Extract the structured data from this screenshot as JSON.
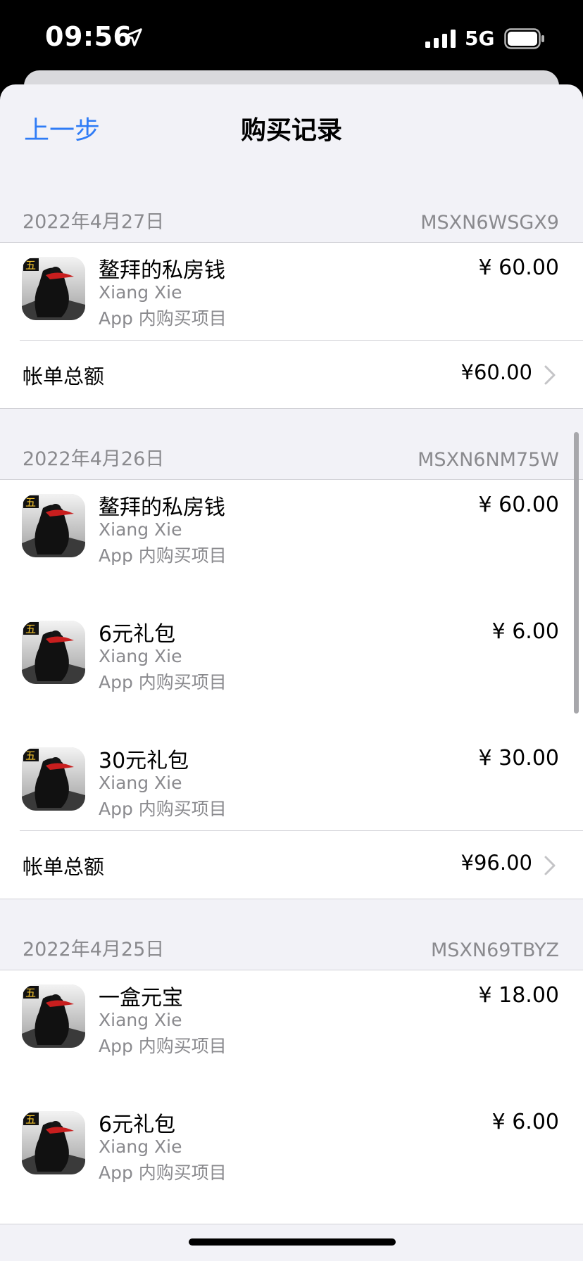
{
  "status": {
    "time": "09:56",
    "network": "5G"
  },
  "nav": {
    "back": "上一步",
    "title": "购买记录"
  },
  "sections": [
    {
      "date": "2022年4月27日",
      "order_id": "MSXN6WSGX9",
      "items": [
        {
          "name": "鳌拜的私房钱",
          "developer": "Xiang Xie",
          "type": "App 内购买项目",
          "price": "¥ 60.00"
        }
      ],
      "total_label": "帐单总额",
      "total": "¥60.00"
    },
    {
      "date": "2022年4月26日",
      "order_id": "MSXN6NM75W",
      "items": [
        {
          "name": "鳌拜的私房钱",
          "developer": "Xiang Xie",
          "type": "App 内购买项目",
          "price": "¥ 60.00"
        },
        {
          "name": "6元礼包",
          "developer": "Xiang Xie",
          "type": "App 内购买项目",
          "price": "¥ 6.00"
        },
        {
          "name": "30元礼包",
          "developer": "Xiang Xie",
          "type": "App 内购买项目",
          "price": "¥ 30.00"
        }
      ],
      "total_label": "帐单总额",
      "total": "¥96.00"
    },
    {
      "date": "2022年4月25日",
      "order_id": "MSXN69TBYZ",
      "items": [
        {
          "name": "一盒元宝",
          "developer": "Xiang Xie",
          "type": "App 内购买项目",
          "price": "¥ 18.00"
        },
        {
          "name": "6元礼包",
          "developer": "Xiang Xie",
          "type": "App 内购买项目",
          "price": "¥ 6.00"
        }
      ]
    }
  ],
  "colors": {
    "accent": "#2f7cf6",
    "background": "#f2f2f7",
    "secondary_text": "#8a8a8e"
  },
  "icons": [
    "location-arrow-icon",
    "cellular-signal-icon",
    "battery-icon",
    "chevron-right-icon",
    "app-icon"
  ]
}
